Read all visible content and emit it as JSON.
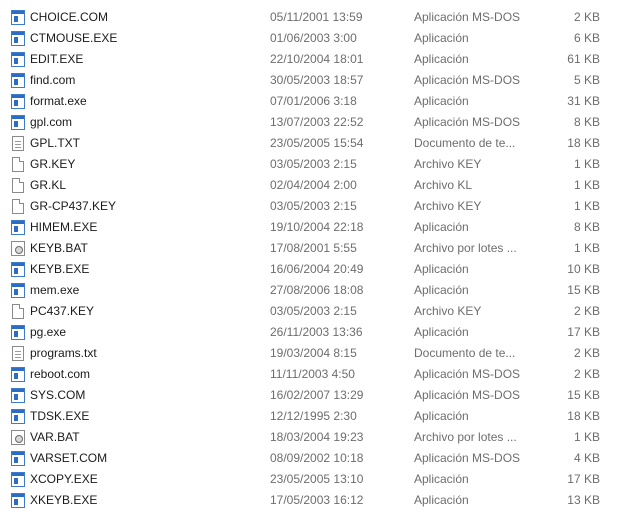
{
  "files": [
    {
      "name": "CHOICE.COM",
      "date": "05/11/2001 13:59",
      "type": "Aplicación MS-DOS",
      "size": "2 KB",
      "icon": "app-icon"
    },
    {
      "name": "CTMOUSE.EXE",
      "date": "01/06/2003 3:00",
      "type": "Aplicación",
      "size": "6 KB",
      "icon": "app-icon"
    },
    {
      "name": "EDIT.EXE",
      "date": "22/10/2004 18:01",
      "type": "Aplicación",
      "size": "61 KB",
      "icon": "app-icon"
    },
    {
      "name": "find.com",
      "date": "30/05/2003 18:57",
      "type": "Aplicación MS-DOS",
      "size": "5 KB",
      "icon": "app-icon"
    },
    {
      "name": "format.exe",
      "date": "07/01/2006 3:18",
      "type": "Aplicación",
      "size": "31 KB",
      "icon": "app-icon"
    },
    {
      "name": "gpl.com",
      "date": "13/07/2003 22:52",
      "type": "Aplicación MS-DOS",
      "size": "8 KB",
      "icon": "app-icon"
    },
    {
      "name": "GPL.TXT",
      "date": "23/05/2005 15:54",
      "type": "Documento de te...",
      "size": "18 KB",
      "icon": "text-file-icon"
    },
    {
      "name": "GR.KEY",
      "date": "03/05/2003 2:15",
      "type": "Archivo KEY",
      "size": "1 KB",
      "icon": "file-icon"
    },
    {
      "name": "GR.KL",
      "date": "02/04/2004 2:00",
      "type": "Archivo KL",
      "size": "1 KB",
      "icon": "file-icon"
    },
    {
      "name": "GR-CP437.KEY",
      "date": "03/05/2003 2:15",
      "type": "Archivo KEY",
      "size": "1 KB",
      "icon": "file-icon"
    },
    {
      "name": "HIMEM.EXE",
      "date": "19/10/2004 22:18",
      "type": "Aplicación",
      "size": "8 KB",
      "icon": "app-icon"
    },
    {
      "name": "KEYB.BAT",
      "date": "17/08/2001 5:55",
      "type": "Archivo por lotes ...",
      "size": "1 KB",
      "icon": "batch-file-icon"
    },
    {
      "name": "KEYB.EXE",
      "date": "16/06/2004 20:49",
      "type": "Aplicación",
      "size": "10 KB",
      "icon": "app-icon"
    },
    {
      "name": "mem.exe",
      "date": "27/08/2006 18:08",
      "type": "Aplicación",
      "size": "15 KB",
      "icon": "app-icon"
    },
    {
      "name": "PC437.KEY",
      "date": "03/05/2003 2:15",
      "type": "Archivo KEY",
      "size": "2 KB",
      "icon": "file-icon"
    },
    {
      "name": "pg.exe",
      "date": "26/11/2003 13:36",
      "type": "Aplicación",
      "size": "17 KB",
      "icon": "app-icon"
    },
    {
      "name": "programs.txt",
      "date": "19/03/2004 8:15",
      "type": "Documento de te...",
      "size": "2 KB",
      "icon": "text-file-icon"
    },
    {
      "name": "reboot.com",
      "date": "11/11/2003 4:50",
      "type": "Aplicación MS-DOS",
      "size": "2 KB",
      "icon": "app-icon"
    },
    {
      "name": "SYS.COM",
      "date": "16/02/2007 13:29",
      "type": "Aplicación MS-DOS",
      "size": "15 KB",
      "icon": "app-icon"
    },
    {
      "name": "TDSK.EXE",
      "date": "12/12/1995 2:30",
      "type": "Aplicación",
      "size": "18 KB",
      "icon": "app-icon"
    },
    {
      "name": "VAR.BAT",
      "date": "18/03/2004 19:23",
      "type": "Archivo por lotes ...",
      "size": "1 KB",
      "icon": "batch-file-icon"
    },
    {
      "name": "VARSET.COM",
      "date": "08/09/2002 10:18",
      "type": "Aplicación MS-DOS",
      "size": "4 KB",
      "icon": "app-icon"
    },
    {
      "name": "XCOPY.EXE",
      "date": "23/05/2005 13:10",
      "type": "Aplicación",
      "size": "17 KB",
      "icon": "app-icon"
    },
    {
      "name": "XKEYB.EXE",
      "date": "17/05/2003 16:12",
      "type": "Aplicación",
      "size": "13 KB",
      "icon": "app-icon"
    }
  ]
}
